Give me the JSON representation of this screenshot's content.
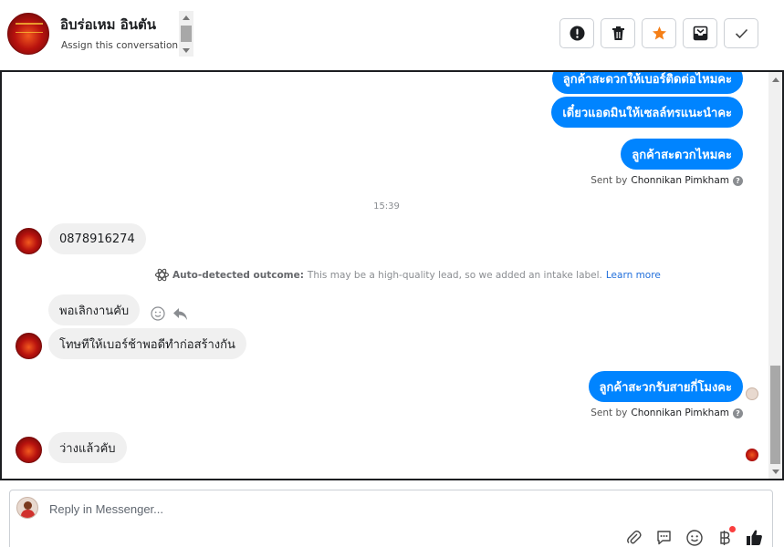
{
  "header": {
    "contact_name": "อิบร่อเหม อินตัน",
    "assign_label": "Assign this conversation"
  },
  "actions": [
    {
      "name": "mark-spam-button",
      "icon": "alert-icon",
      "color": "#1c1e21"
    },
    {
      "name": "delete-button",
      "icon": "trash-icon",
      "color": "#1c1e21"
    },
    {
      "name": "star-button",
      "icon": "star-icon",
      "color": "#f57f17"
    },
    {
      "name": "move-to-inbox-button",
      "icon": "inbox-icon",
      "color": "#1c1e21"
    },
    {
      "name": "mark-done-button",
      "icon": "check-icon",
      "color": "#1c1e21"
    }
  ],
  "conversation": {
    "out_msg_1": "ลูกค้าสะดวกให้เบอร์ติดต่อไหมคะ",
    "out_msg_2": "เดี๋ยวแอดมินให้เซลล์ทรแนะนำคะ",
    "out_msg_3": "ลูกค้าสะดวกไหมคะ",
    "sent_by_1": {
      "prefix": "Sent by",
      "name": "Chonnikan Pimkham"
    },
    "timestamp": "15:39",
    "in_msg_1": "0878916274",
    "outcome": {
      "title": "Auto-detected outcome:",
      "text": "This may be a high-quality lead, so we added an intake label.",
      "link": "Learn more"
    },
    "in_msg_2": "พอเลิกงานคับ",
    "in_msg_3": "โทษทีให้เบอร์ช้าพอดีทำก่อสร้างกัน",
    "out_msg_4": "ลูกค้าสะวกรับสายกี่โมงคะ",
    "sent_by_2": {
      "prefix": "Sent by",
      "name": "Chonnikan Pimkham"
    },
    "in_msg_4": "ว่างแล้วคับ"
  },
  "composer": {
    "placeholder": "Reply in Messenger..."
  },
  "colors": {
    "accent": "#0084ff",
    "link": "#216fdb",
    "notification": "#fa3e3e"
  }
}
